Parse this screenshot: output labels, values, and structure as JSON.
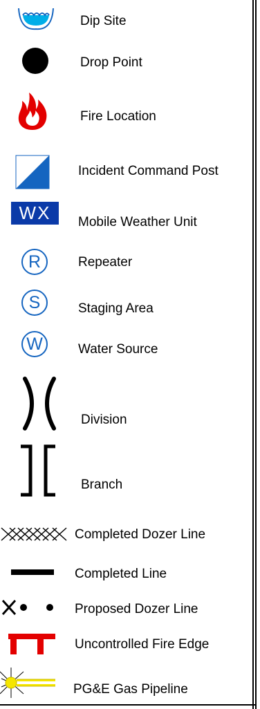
{
  "legend": {
    "items": [
      {
        "label": "Dip Site",
        "icon": "dip-site-icon"
      },
      {
        "label": "Drop Point",
        "icon": "drop-point-icon"
      },
      {
        "label": "Fire Location",
        "icon": "fire-icon"
      },
      {
        "label": "Incident Command Post",
        "icon": "incident-command-post-icon"
      },
      {
        "label": "Mobile Weather Unit",
        "icon": "mobile-weather-unit-icon"
      },
      {
        "label": "Repeater",
        "icon": "repeater-icon"
      },
      {
        "label": "Staging Area",
        "icon": "staging-area-icon"
      },
      {
        "label": "Water Source",
        "icon": "water-source-icon"
      },
      {
        "label": "Division",
        "icon": "division-icon"
      },
      {
        "label": "Branch",
        "icon": "branch-icon"
      },
      {
        "label": "Completed Dozer Line",
        "icon": "completed-dozer-line-icon"
      },
      {
        "label": "Completed Line",
        "icon": "completed-line-icon"
      },
      {
        "label": "Proposed Dozer Line",
        "icon": "proposed-dozer-line-icon"
      },
      {
        "label": "Uncontrolled Fire Edge",
        "icon": "uncontrolled-fire-edge-icon"
      },
      {
        "label": "PG&E Gas Pipeline",
        "icon": "gas-pipeline-icon"
      }
    ],
    "symbols": {
      "weather": "WX",
      "repeater": "R",
      "staging": "S",
      "water": "W"
    },
    "colors": {
      "blue": "#1565c0",
      "navy": "#0a3aa8",
      "cyan": "#00aee8",
      "red": "#e30000",
      "yellow": "#f5e600"
    }
  }
}
